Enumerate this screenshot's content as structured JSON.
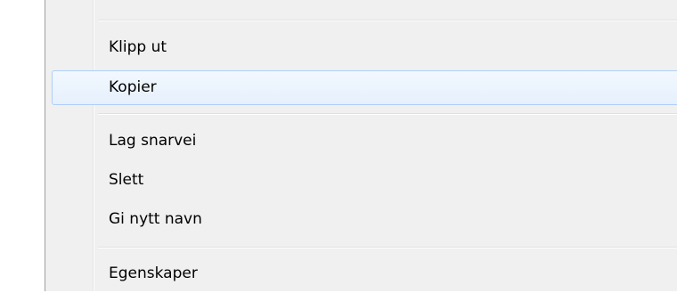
{
  "context_menu": {
    "items": [
      {
        "label": "Klipp ut"
      },
      {
        "label": "Kopier",
        "highlighted": true
      },
      {
        "label": "Lag snarvei"
      },
      {
        "label": "Slett"
      },
      {
        "label": "Gi nytt navn"
      },
      {
        "label": "Egenskaper"
      }
    ]
  }
}
